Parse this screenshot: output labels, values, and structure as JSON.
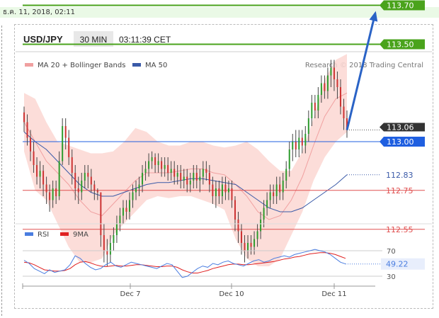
{
  "date_stamp": "ธ.ค. 11, 2018, 02:11",
  "header": {
    "symbol": "USD/JPY",
    "interval": "30 MIN",
    "time": "03:11:39 CET"
  },
  "legend": {
    "bb_label": "MA 20 + Bollinger Bands",
    "ma_label": "MA 50"
  },
  "credit": "Research © 2018 Trading Central",
  "colors": {
    "resistance": "#4aa31c",
    "pivot": "#1f5fe0",
    "support": "#e05050",
    "bb_fill": "#fcd7d2",
    "candle_up": "#2d9b2d",
    "candle_down": "#cc3333",
    "ma50": "#3a5aa8",
    "ma20": "#f0a0a0",
    "arrow": "#2a63c6",
    "rsi": "#4a7de0",
    "rsi_ma": "#e02020",
    "last_price_bg": "#333333"
  },
  "chart_data": [
    {
      "type": "candlestick",
      "series": [
        {
          "name": "MA 20 + Bollinger Bands"
        },
        {
          "name": "MA 50"
        }
      ],
      "x_ticks": [
        "Dec 7",
        "Dec 10",
        "Dec 11"
      ],
      "ylim": [
        112.4,
        113.8
      ],
      "levels": [
        {
          "label": "113.70",
          "value": 113.7,
          "kind": "resistance"
        },
        {
          "label": "113.50",
          "value": 113.5,
          "kind": "resistance"
        },
        {
          "label": "113.00",
          "value": 113.0,
          "kind": "pivot"
        },
        {
          "label": "112.75",
          "value": 112.75,
          "kind": "support"
        },
        {
          "label": "112.55",
          "value": 112.55,
          "kind": "support"
        }
      ],
      "last_price": {
        "label": "113.06",
        "value": 113.06
      },
      "ma50_last": {
        "label": "112.83",
        "value": 112.83
      },
      "bb": {
        "upper": [
          113.25,
          113.22,
          113.1,
          113.0,
          112.98,
          112.96,
          112.94,
          112.94,
          112.95,
          113.0,
          113.07,
          113.05,
          113.0,
          112.98,
          112.98,
          113.0,
          113.0,
          112.98,
          112.97,
          112.98,
          113.0,
          112.96,
          112.9,
          112.85,
          112.85,
          112.95,
          113.12,
          113.32,
          113.42,
          113.45
        ],
        "middle": [
          113.1,
          113.0,
          112.9,
          112.84,
          112.78,
          112.7,
          112.64,
          112.62,
          112.68,
          112.74,
          112.8,
          112.84,
          112.84,
          112.84,
          112.85,
          112.86,
          112.86,
          112.84,
          112.83,
          112.78,
          112.72,
          112.64,
          112.6,
          112.62,
          112.7,
          112.82,
          112.98,
          113.13,
          113.22,
          113.25
        ],
        "lower": [
          112.95,
          112.75,
          112.7,
          112.58,
          112.46,
          112.38,
          112.38,
          112.4,
          112.52,
          112.58,
          112.64,
          112.7,
          112.72,
          112.71,
          112.72,
          112.72,
          112.7,
          112.68,
          112.65,
          112.5,
          112.4,
          112.36,
          112.36,
          112.4,
          112.52,
          112.64,
          112.8,
          112.92,
          113.0,
          113.05
        ]
      },
      "ma50": [
        113.05,
        113.0,
        112.96,
        112.9,
        112.84,
        112.78,
        112.74,
        112.72,
        112.72,
        112.74,
        112.76,
        112.78,
        112.79,
        112.79,
        112.8,
        112.81,
        112.81,
        112.8,
        112.79,
        112.78,
        112.74,
        112.7,
        112.66,
        112.64,
        112.64,
        112.66,
        112.7,
        112.74,
        112.78,
        112.83
      ],
      "candles": [
        [
          113.15,
          113.1,
          113.18,
          113.05
        ],
        [
          113.1,
          113.02,
          113.14,
          112.98
        ],
        [
          113.02,
          112.95,
          113.06,
          112.9
        ],
        [
          112.95,
          112.88,
          113.0,
          112.84
        ],
        [
          112.88,
          112.82,
          112.92,
          112.78
        ],
        [
          112.82,
          112.85,
          112.9,
          112.76
        ],
        [
          112.85,
          112.78,
          112.88,
          112.72
        ],
        [
          112.78,
          112.74,
          112.82,
          112.68
        ],
        [
          112.74,
          112.7,
          112.78,
          112.64
        ],
        [
          112.7,
          112.76,
          112.8,
          112.66
        ],
        [
          112.76,
          112.72,
          112.8,
          112.68
        ],
        [
          112.72,
          112.9,
          112.95,
          112.7
        ],
        [
          112.9,
          113.08,
          113.12,
          112.88
        ],
        [
          113.08,
          113.02,
          113.12,
          112.96
        ],
        [
          113.02,
          112.92,
          113.06,
          112.88
        ],
        [
          112.92,
          112.84,
          112.96,
          112.78
        ],
        [
          112.84,
          112.76,
          112.88,
          112.7
        ],
        [
          112.76,
          112.74,
          112.82,
          112.68
        ],
        [
          112.74,
          112.8,
          112.84,
          112.7
        ],
        [
          112.8,
          112.84,
          112.88,
          112.76
        ],
        [
          112.84,
          112.82,
          112.88,
          112.76
        ],
        [
          112.82,
          112.78,
          112.86,
          112.74
        ],
        [
          112.78,
          112.75,
          112.8,
          112.7
        ],
        [
          112.75,
          112.74,
          112.76,
          112.7
        ],
        [
          112.74,
          112.52,
          112.74,
          112.46
        ],
        [
          112.52,
          112.44,
          112.58,
          112.38
        ],
        [
          112.44,
          112.42,
          112.5,
          112.36
        ],
        [
          112.42,
          112.48,
          112.52,
          112.38
        ],
        [
          112.48,
          112.52,
          112.56,
          112.44
        ],
        [
          112.52,
          112.58,
          112.62,
          112.48
        ],
        [
          112.58,
          112.62,
          112.66,
          112.54
        ],
        [
          112.62,
          112.66,
          112.7,
          112.58
        ],
        [
          112.66,
          112.64,
          112.7,
          112.6
        ],
        [
          112.64,
          112.7,
          112.74,
          112.6
        ],
        [
          112.7,
          112.74,
          112.78,
          112.66
        ],
        [
          112.74,
          112.76,
          112.8,
          112.7
        ],
        [
          112.76,
          112.78,
          112.82,
          112.72
        ],
        [
          112.78,
          112.84,
          112.88,
          112.74
        ],
        [
          112.84,
          112.86,
          112.9,
          112.8
        ],
        [
          112.86,
          112.9,
          112.94,
          112.82
        ],
        [
          112.9,
          112.92,
          112.95,
          112.86
        ],
        [
          112.92,
          112.88,
          112.94,
          112.84
        ],
        [
          112.88,
          112.9,
          112.94,
          112.84
        ],
        [
          112.9,
          112.86,
          112.92,
          112.82
        ],
        [
          112.86,
          112.88,
          112.92,
          112.82
        ],
        [
          112.88,
          112.84,
          112.92,
          112.8
        ],
        [
          112.84,
          112.86,
          112.9,
          112.8
        ],
        [
          112.86,
          112.82,
          112.9,
          112.78
        ],
        [
          112.82,
          112.84,
          112.88,
          112.78
        ],
        [
          112.84,
          112.8,
          112.88,
          112.76
        ],
        [
          112.8,
          112.82,
          112.86,
          112.76
        ],
        [
          112.82,
          112.78,
          112.86,
          112.74
        ],
        [
          112.78,
          112.8,
          112.84,
          112.74
        ],
        [
          112.8,
          112.84,
          112.88,
          112.76
        ],
        [
          112.84,
          112.8,
          112.88,
          112.76
        ],
        [
          112.8,
          112.82,
          112.86,
          112.74
        ],
        [
          112.82,
          112.86,
          112.9,
          112.78
        ],
        [
          112.86,
          112.84,
          112.9,
          112.8
        ],
        [
          112.84,
          112.78,
          112.88,
          112.74
        ],
        [
          112.78,
          112.72,
          112.82,
          112.68
        ],
        [
          112.72,
          112.76,
          112.8,
          112.66
        ],
        [
          112.76,
          112.72,
          112.8,
          112.68
        ],
        [
          112.72,
          112.78,
          112.82,
          112.68
        ],
        [
          112.78,
          112.74,
          112.82,
          112.7
        ],
        [
          112.74,
          112.76,
          112.8,
          112.7
        ],
        [
          112.76,
          112.7,
          112.8,
          112.66
        ],
        [
          112.7,
          112.6,
          112.72,
          112.54
        ],
        [
          112.6,
          112.54,
          112.64,
          112.48
        ],
        [
          112.54,
          112.48,
          112.58,
          112.42
        ],
        [
          112.48,
          112.44,
          112.52,
          112.38
        ],
        [
          112.44,
          112.48,
          112.52,
          112.4
        ],
        [
          112.48,
          112.46,
          112.52,
          112.42
        ],
        [
          112.46,
          112.5,
          112.54,
          112.42
        ],
        [
          112.5,
          112.54,
          112.58,
          112.46
        ],
        [
          112.54,
          112.6,
          112.64,
          112.5
        ],
        [
          112.6,
          112.66,
          112.7,
          112.56
        ],
        [
          112.66,
          112.7,
          112.74,
          112.62
        ],
        [
          112.7,
          112.74,
          112.78,
          112.66
        ],
        [
          112.74,
          112.72,
          112.78,
          112.68
        ],
        [
          112.72,
          112.78,
          112.82,
          112.68
        ],
        [
          112.78,
          112.74,
          112.82,
          112.7
        ],
        [
          112.74,
          112.8,
          112.84,
          112.7
        ],
        [
          112.8,
          112.86,
          112.9,
          112.76
        ],
        [
          112.86,
          112.96,
          113.0,
          112.82
        ],
        [
          112.96,
          113.0,
          113.04,
          112.9
        ],
        [
          113.0,
          112.96,
          113.06,
          112.92
        ],
        [
          112.96,
          113.02,
          113.06,
          112.92
        ],
        [
          113.02,
          112.98,
          113.06,
          112.94
        ],
        [
          112.98,
          113.04,
          113.08,
          112.94
        ],
        [
          113.04,
          113.12,
          113.16,
          113.0
        ],
        [
          113.12,
          113.2,
          113.24,
          113.08
        ],
        [
          113.2,
          113.16,
          113.24,
          113.12
        ],
        [
          113.16,
          113.24,
          113.28,
          113.12
        ],
        [
          113.24,
          113.3,
          113.34,
          113.2
        ],
        [
          113.3,
          113.26,
          113.34,
          113.22
        ],
        [
          113.26,
          113.34,
          113.38,
          113.22
        ],
        [
          113.34,
          113.38,
          113.42,
          113.28
        ],
        [
          113.38,
          113.32,
          113.42,
          113.26
        ],
        [
          113.32,
          113.28,
          113.36,
          113.22
        ],
        [
          113.28,
          113.18,
          113.32,
          113.14
        ],
        [
          113.18,
          113.12,
          113.22,
          113.06
        ],
        [
          113.12,
          113.06,
          113.16,
          113.02
        ]
      ]
    },
    {
      "type": "line",
      "title": "RSI",
      "series": [
        {
          "name": "RSI",
          "values": [
            55,
            50,
            42,
            38,
            34,
            40,
            36,
            38,
            40,
            48,
            62,
            58,
            50,
            44,
            40,
            42,
            48,
            52,
            46,
            44,
            48,
            52,
            50,
            48,
            46,
            44,
            42,
            46,
            50,
            48,
            38,
            28,
            30,
            36,
            42,
            46,
            44,
            50,
            48,
            52,
            54,
            50,
            48,
            46,
            50,
            54,
            56,
            52,
            54,
            58,
            60,
            62,
            60,
            64,
            66,
            68,
            70,
            72,
            70,
            68,
            64,
            58,
            52,
            49.22
          ]
        },
        {
          "name": "9MA",
          "values": [
            52,
            51,
            48,
            44,
            40,
            39,
            38,
            38,
            39,
            42,
            48,
            52,
            53,
            51,
            48,
            46,
            45,
            46,
            47,
            46,
            46,
            47,
            48,
            48,
            47,
            46,
            45,
            45,
            46,
            46,
            44,
            40,
            37,
            35,
            35,
            37,
            39,
            42,
            44,
            46,
            48,
            49,
            49,
            48,
            48,
            49,
            50,
            51,
            52,
            53,
            55,
            57,
            58,
            60,
            61,
            63,
            65,
            66,
            67,
            67,
            66,
            64,
            61,
            58
          ]
        }
      ],
      "levels": [
        {
          "label": "70",
          "value": 70
        },
        {
          "label": "30",
          "value": 30
        }
      ],
      "last_value": {
        "label": "49.22",
        "value": 49.22
      },
      "ylim": [
        20,
        80
      ]
    }
  ]
}
